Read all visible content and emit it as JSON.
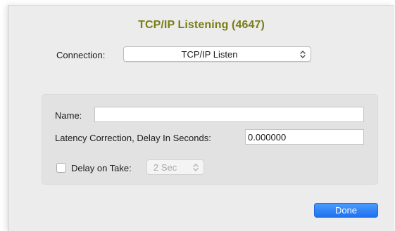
{
  "window": {
    "title": "TCP/IP Listening (4647)"
  },
  "connection": {
    "label": "Connection:",
    "selected": "TCP/IP Listen"
  },
  "settings": {
    "name_label": "Name:",
    "name_value": "",
    "latency_label": "Latency Correction, Delay In Seconds:",
    "latency_value": "0.000000",
    "delay_on_take_label": "Delay on Take:",
    "delay_on_take_checked": false,
    "delay_on_take_selected": "2 Sec",
    "delay_on_take_enabled": false
  },
  "footer": {
    "done_label": "Done"
  },
  "colors": {
    "title": "#7b7d16",
    "accent": "#1f72f0"
  },
  "icons": {
    "popup_chevrons": "chevron-up-down-icon"
  }
}
